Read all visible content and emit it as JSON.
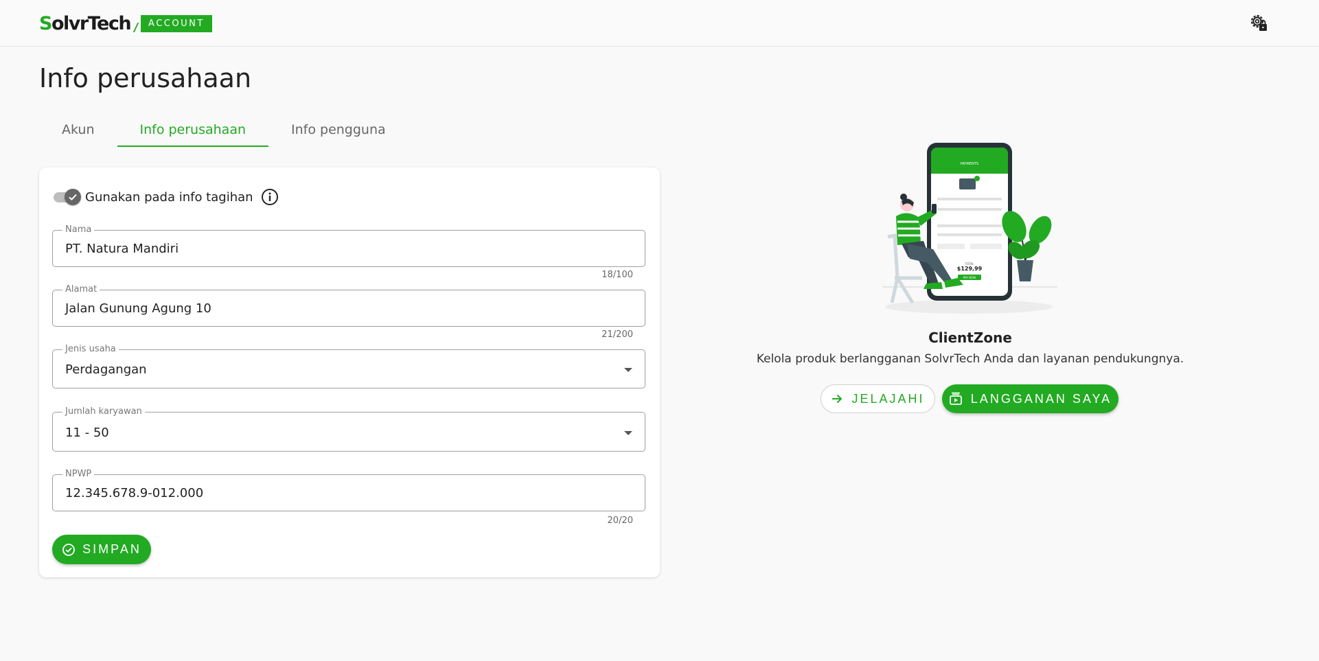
{
  "header": {
    "logo_text": "SolvrTech",
    "badge": "ACCOUNT",
    "settings_icon": "settings-gear-lock-icon"
  },
  "page": {
    "title": "Info perusahaan"
  },
  "tabs": [
    {
      "label": "Akun",
      "active": false
    },
    {
      "label": "Info perusahaan",
      "active": true
    },
    {
      "label": "Info pengguna",
      "active": false
    }
  ],
  "form": {
    "toggle": {
      "label": "Gunakan pada info tagihan",
      "checked": true
    },
    "nama": {
      "label": "Nama",
      "value": "PT. Natura Mandiri",
      "counter": "18/100"
    },
    "alamat": {
      "label": "Alamat",
      "value": "Jalan Gunung Agung 10",
      "counter": "21/200"
    },
    "jenis_usaha": {
      "label": "Jenis usaha",
      "value": "Perdagangan"
    },
    "jumlah_karyawan": {
      "label": "Jumlah karyawan",
      "value": "11 - 50"
    },
    "npwp": {
      "label": "NPWP",
      "value": "12.345.678.9-012.000",
      "counter": "20/20"
    },
    "save_label": "SIMPAN"
  },
  "promo": {
    "title": "ClientZone",
    "description": "Kelola produk berlangganan SolvrTech Anda dan layanan pendukungnya.",
    "explore_label": "JELAJAHI",
    "subscriptions_label": "LANGGANAN SAYA",
    "phone_header": "PAYMENTS",
    "phone_total_label": "TOTAL",
    "phone_total": "$129,99",
    "phone_pay_label": "PAY NOW"
  },
  "colors": {
    "accent": "#22aa22",
    "background": "#f9f9f9"
  }
}
